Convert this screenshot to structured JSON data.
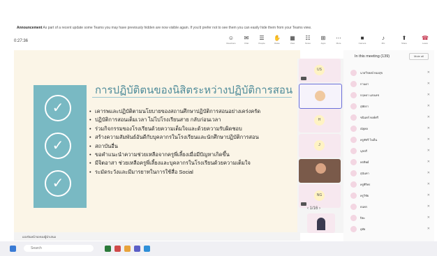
{
  "announcement": {
    "label": "Announcement",
    "text": "As part of a recent update some Teams you may have previously hidden are now visible again. If you'd prefer not to see them you can easily hide them from your Teams view."
  },
  "meeting": {
    "timer": "0:27:36"
  },
  "toolbar": {
    "items": [
      {
        "label": "Reactions",
        "icon": "smile-icon"
      },
      {
        "label": "Chat",
        "icon": "chat-icon"
      },
      {
        "label": "People",
        "icon": "people-icon",
        "count": "139"
      },
      {
        "label": "Raise",
        "icon": "hand-icon"
      },
      {
        "label": "View",
        "icon": "view-icon"
      },
      {
        "label": "Notes",
        "icon": "notes-icon"
      },
      {
        "label": "Apps",
        "icon": "apps-icon"
      },
      {
        "label": "More",
        "icon": "more-icon"
      },
      {
        "label": "Camera",
        "icon": "camera-icon"
      },
      {
        "label": "Mic",
        "icon": "mic-icon"
      },
      {
        "label": "Share",
        "icon": "share-icon"
      },
      {
        "label": "Leave",
        "icon": "leave-icon"
      }
    ]
  },
  "slide": {
    "title": "การปฏิบัติตนของนิสิตระหว่างปฏิบัติการสอน",
    "bullets": [
      "เคารพและปฏิบัติตามนโยบายของสถานศึกษาปฏิบัติการสอนอย่างเคร่งครัด",
      "ปฏิบัติการสอนเต็มเวลา ไม่ไปโรงเรียนสาย กลับก่อนเวลา",
      "ร่วมกิจกรรมของโรงเรียนด้วยความเต็มใจและด้วยความรับผิดชอบ",
      "สร้างความสัมพันธ์อันดีกับบุคลากรในโรงเรียนและนักศึกษาปฏิบัติการสอน",
      "สถาบันอื่น",
      "ขอคำแนะนำความช่วยเหลือจากครูพี่เลี้ยงเมื่อมีปัญหาเกิดขึ้น",
      "มีจิตอาสา ช่วยเหลือครูพี่เลี้ยงและบุคลากรในโรงเรียนด้วยความเต็มใจ",
      "ระมัดระวังและมีมารยาทในการใช้สื่อ Social"
    ]
  },
  "filmstrip": {
    "tiles": [
      "US",
      "",
      "H",
      "J",
      "",
      "NG",
      ""
    ],
    "pager": "1/16"
  },
  "panel": {
    "title": "In this meeting (139)",
    "more_label": "Mute all",
    "participants": [
      "นายวีรพงษ์ ทองสุข",
      "กานดา",
      "กฤษดา แสงเดช",
      "สุพัตรา",
      "ชนินทร์ พงษ์ศรี",
      "ณัฐพล",
      "ครูพัชรี ใจเย็น",
      "นุชจรี",
      "พรทิพย์",
      "สุนันทา",
      "ครูศิริพร",
      "ครูวิชัย",
      "ธนพร",
      "ปิยะ",
      "อุทัย"
    ]
  },
  "bottom_bar": {
    "label": "แบ่งปันหน้าจอของผู้นำเสนอ"
  },
  "taskbar": {
    "search_placeholder": "Search"
  }
}
